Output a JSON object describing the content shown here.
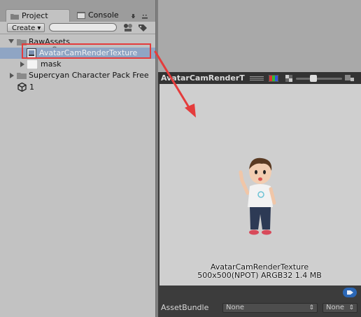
{
  "tabs": {
    "project": "Project",
    "console": "Console"
  },
  "toolbar": {
    "create_label": "Create ▾",
    "search_placeholder": ""
  },
  "tree": {
    "raw_assets": "RawAssets",
    "selected_item": "AvatarCamRenderTexture",
    "mask": "mask",
    "supercyan": "Supercyan Character Pack Free",
    "scene_1": "1"
  },
  "preview": {
    "title": "AvatarCamRenderT",
    "info_line1": "AvatarCamRenderTexture",
    "info_line2": "500x500(NPOT)  ARGB32  1.4 MB"
  },
  "assetbundle": {
    "label": "AssetBundle",
    "name_value": "None",
    "variant_value": "None"
  },
  "colors": {
    "annotation_red": "#e43c3c",
    "selection_blue": "#8fa5c4",
    "dark_header": "#333333"
  }
}
